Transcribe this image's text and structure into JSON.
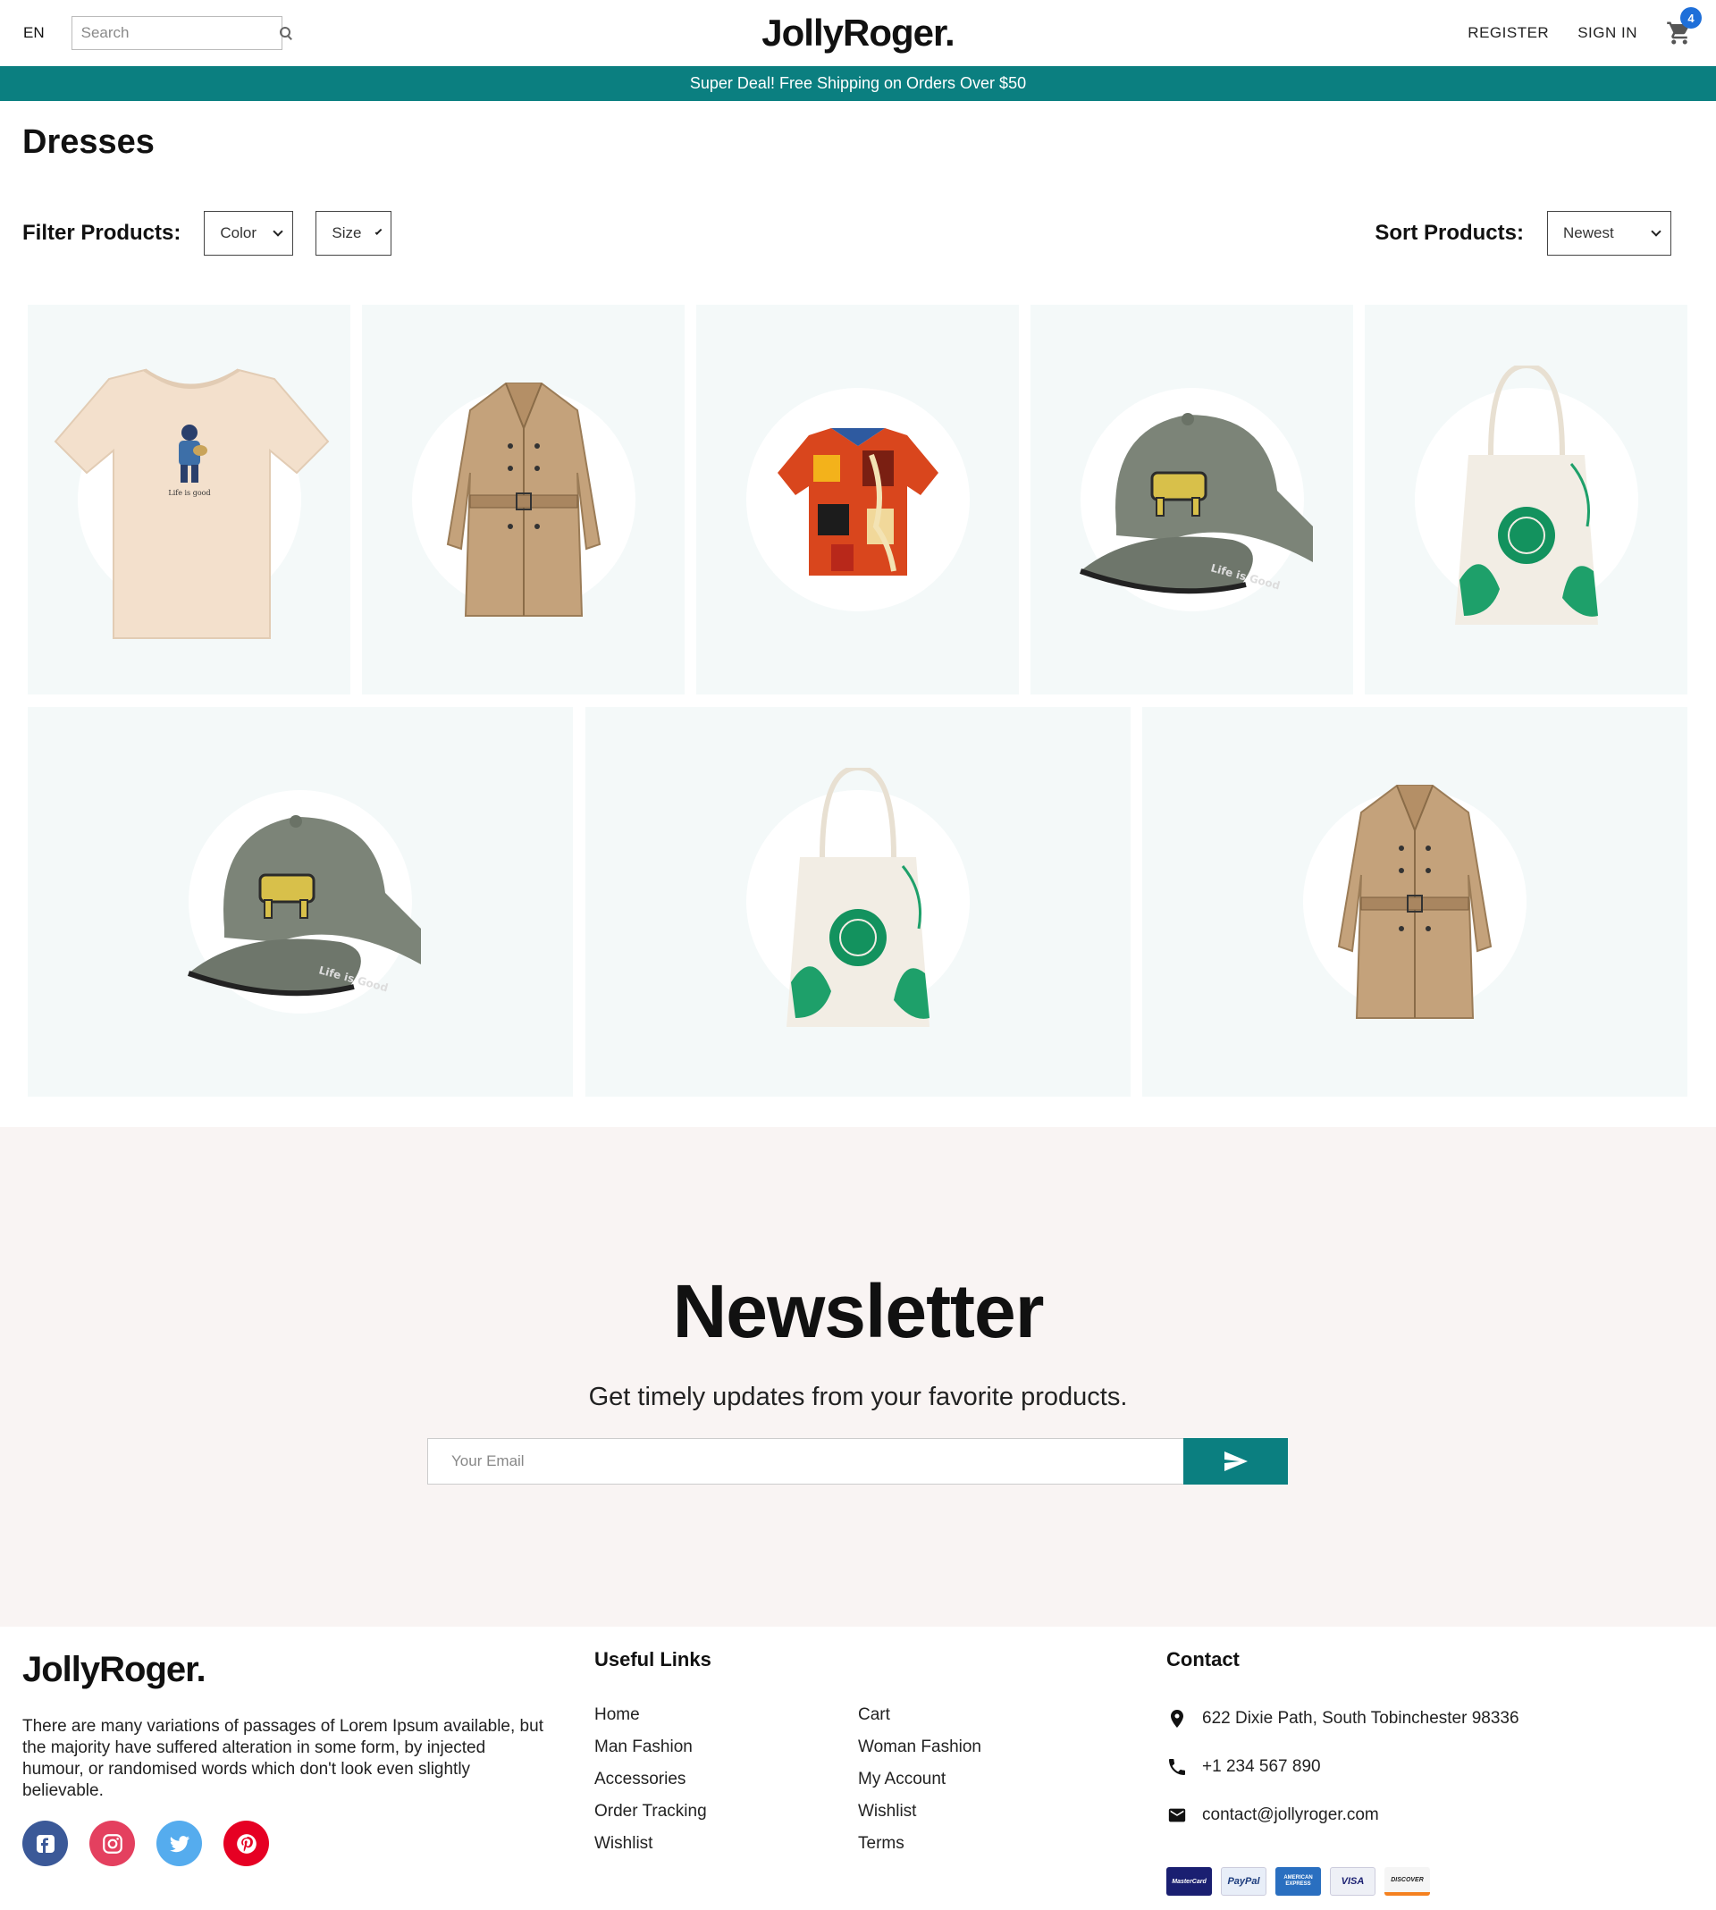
{
  "nav": {
    "lang": "EN",
    "search_placeholder": "Search",
    "logo": "JollyRoger.",
    "register": "REGISTER",
    "sign_in": "SIGN IN",
    "cart_count": "4"
  },
  "announcement": "Super Deal! Free Shipping on Orders Over $50",
  "page_title": "Dresses",
  "filters": {
    "label": "Filter Products:",
    "color": "Color",
    "size": "Size",
    "sort_label": "Sort Products:",
    "sort_value": "Newest"
  },
  "products": [
    {
      "icon": "tshirt-image"
    },
    {
      "icon": "trench-coat-image"
    },
    {
      "icon": "hawaiian-shirt-image"
    },
    {
      "icon": "cap-image"
    },
    {
      "icon": "tote-bag-image"
    },
    {
      "icon": "cap-image"
    },
    {
      "icon": "tote-bag-image"
    },
    {
      "icon": "trench-coat-image"
    }
  ],
  "newsletter": {
    "title": "Newsletter",
    "subtitle": "Get timely updates from your favorite products.",
    "placeholder": "Your Email"
  },
  "footer": {
    "logo": "JollyRoger.",
    "description": "There are many variations of passages of Lorem Ipsum available, but the majority have suffered alteration in some form, by injected humour, or randomised words which don't look even slightly believable.",
    "useful_links_heading": "Useful Links",
    "links_col1": [
      "Home",
      "Man Fashion",
      "Accessories",
      "Order Tracking",
      "Wishlist"
    ],
    "links_col2": [
      "Cart",
      "Woman Fashion",
      "My Account",
      "Wishlist",
      "Terms"
    ],
    "contact_heading": "Contact",
    "address": "622 Dixie Path, South Tobinchester 98336",
    "phone": "+1 234 567 890",
    "email": "contact@jollyroger.com",
    "payments": [
      "MasterCard",
      "PayPal",
      "AMERICAN EXPRESS",
      "VISA",
      "DISCOVER"
    ]
  },
  "colors": {
    "accent": "#0b7f80",
    "card_bg": "#f4f9f9",
    "newsletter_bg": "#f9f4f3",
    "badge": "#1e6fd9"
  }
}
